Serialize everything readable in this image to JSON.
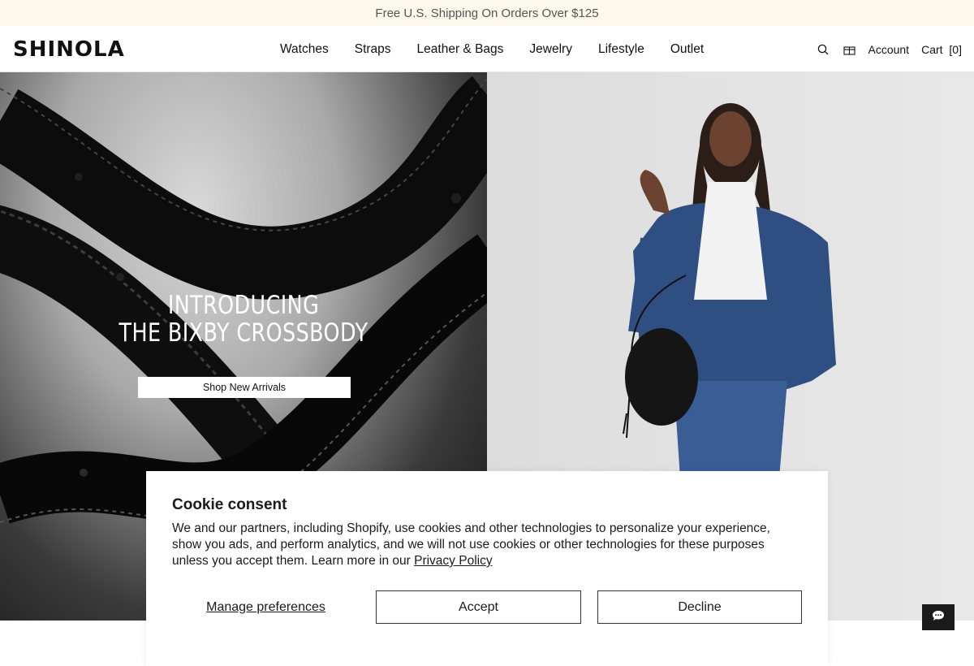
{
  "announcement": {
    "text": "Free U.S. Shipping On Orders Over $125"
  },
  "header": {
    "logo": "SHINOLA",
    "nav": [
      "Watches",
      "Straps",
      "Leather & Bags",
      "Jewelry",
      "Lifestyle",
      "Outlet"
    ],
    "search_icon": "search-icon",
    "gift_icon": "gift-icon",
    "account_label": "Account",
    "cart_label": "Cart",
    "cart_count": "[0]"
  },
  "hero": {
    "title_line1": "INTRODUCING",
    "title_line2": "THE BIXBY CROSSBODY",
    "cta_label": "Shop New Arrivals"
  },
  "cookie": {
    "title": "Cookie consent",
    "body": "We and our partners, including Shopify, use cookies and other technologies to personalize your experience, show you ads, and perform analytics, and we will not use cookies or other technologies for these purposes unless you accept them. Learn more in our ",
    "policy_link": "Privacy Policy",
    "manage_label": "Manage preferences",
    "accept_label": "Accept",
    "decline_label": "Decline"
  },
  "chat": {
    "icon": "chat-icon"
  },
  "colors": {
    "announcement_bg": "#fcf9ec",
    "dark": "#1a1a1a"
  }
}
